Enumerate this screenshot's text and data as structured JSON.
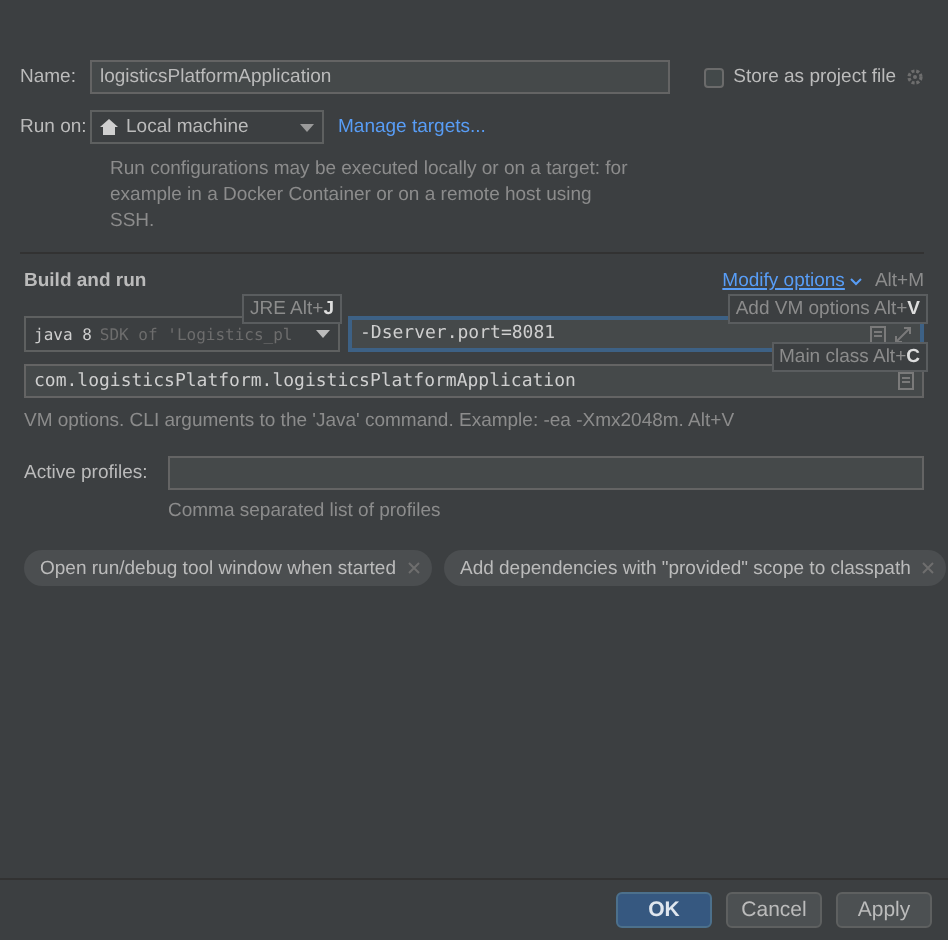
{
  "name_field": {
    "label": "Name:",
    "value": "logisticsPlatformApplication"
  },
  "store_as_project_file": {
    "label": "Store as project file",
    "checked": false
  },
  "run_on": {
    "label": "Run on:",
    "value": "Local machine",
    "link": "Manage targets...",
    "description": "Run configurations may be executed locally or on a target: for example in a Docker Container or on a remote host using SSH."
  },
  "build_and_run": {
    "title": "Build and run",
    "modify_options": {
      "label": "Modify options",
      "shortcut": "Alt+M"
    },
    "jre": {
      "value": "java 8",
      "detail": "SDK of 'Logistics_pl"
    },
    "jre_hint": "JRE Alt+**J**",
    "vm_options": {
      "value": "-Dserver.port=8081",
      "focused": true
    },
    "vm_hint": "Add VM options Alt+**V**",
    "main_class": {
      "value": "com.logisticsPlatform.logisticsPlatformApplication"
    },
    "main_class_hint": "Main class Alt+**C**",
    "help": "VM options. CLI arguments to the 'Java' command. Example: -ea -Xmx2048m. Alt+V"
  },
  "active_profiles": {
    "label": "Active profiles:",
    "hint": "Comma separated list of profiles"
  },
  "options": [
    {
      "label": "Open run/debug tool window when started"
    },
    {
      "label": "Add dependencies with \"provided\" scope to classpath"
    }
  ],
  "buttons": [
    {
      "label": "OK",
      "default": true
    },
    {
      "label": "Cancel",
      "default": false
    },
    {
      "label": "Apply",
      "default": false
    }
  ]
}
